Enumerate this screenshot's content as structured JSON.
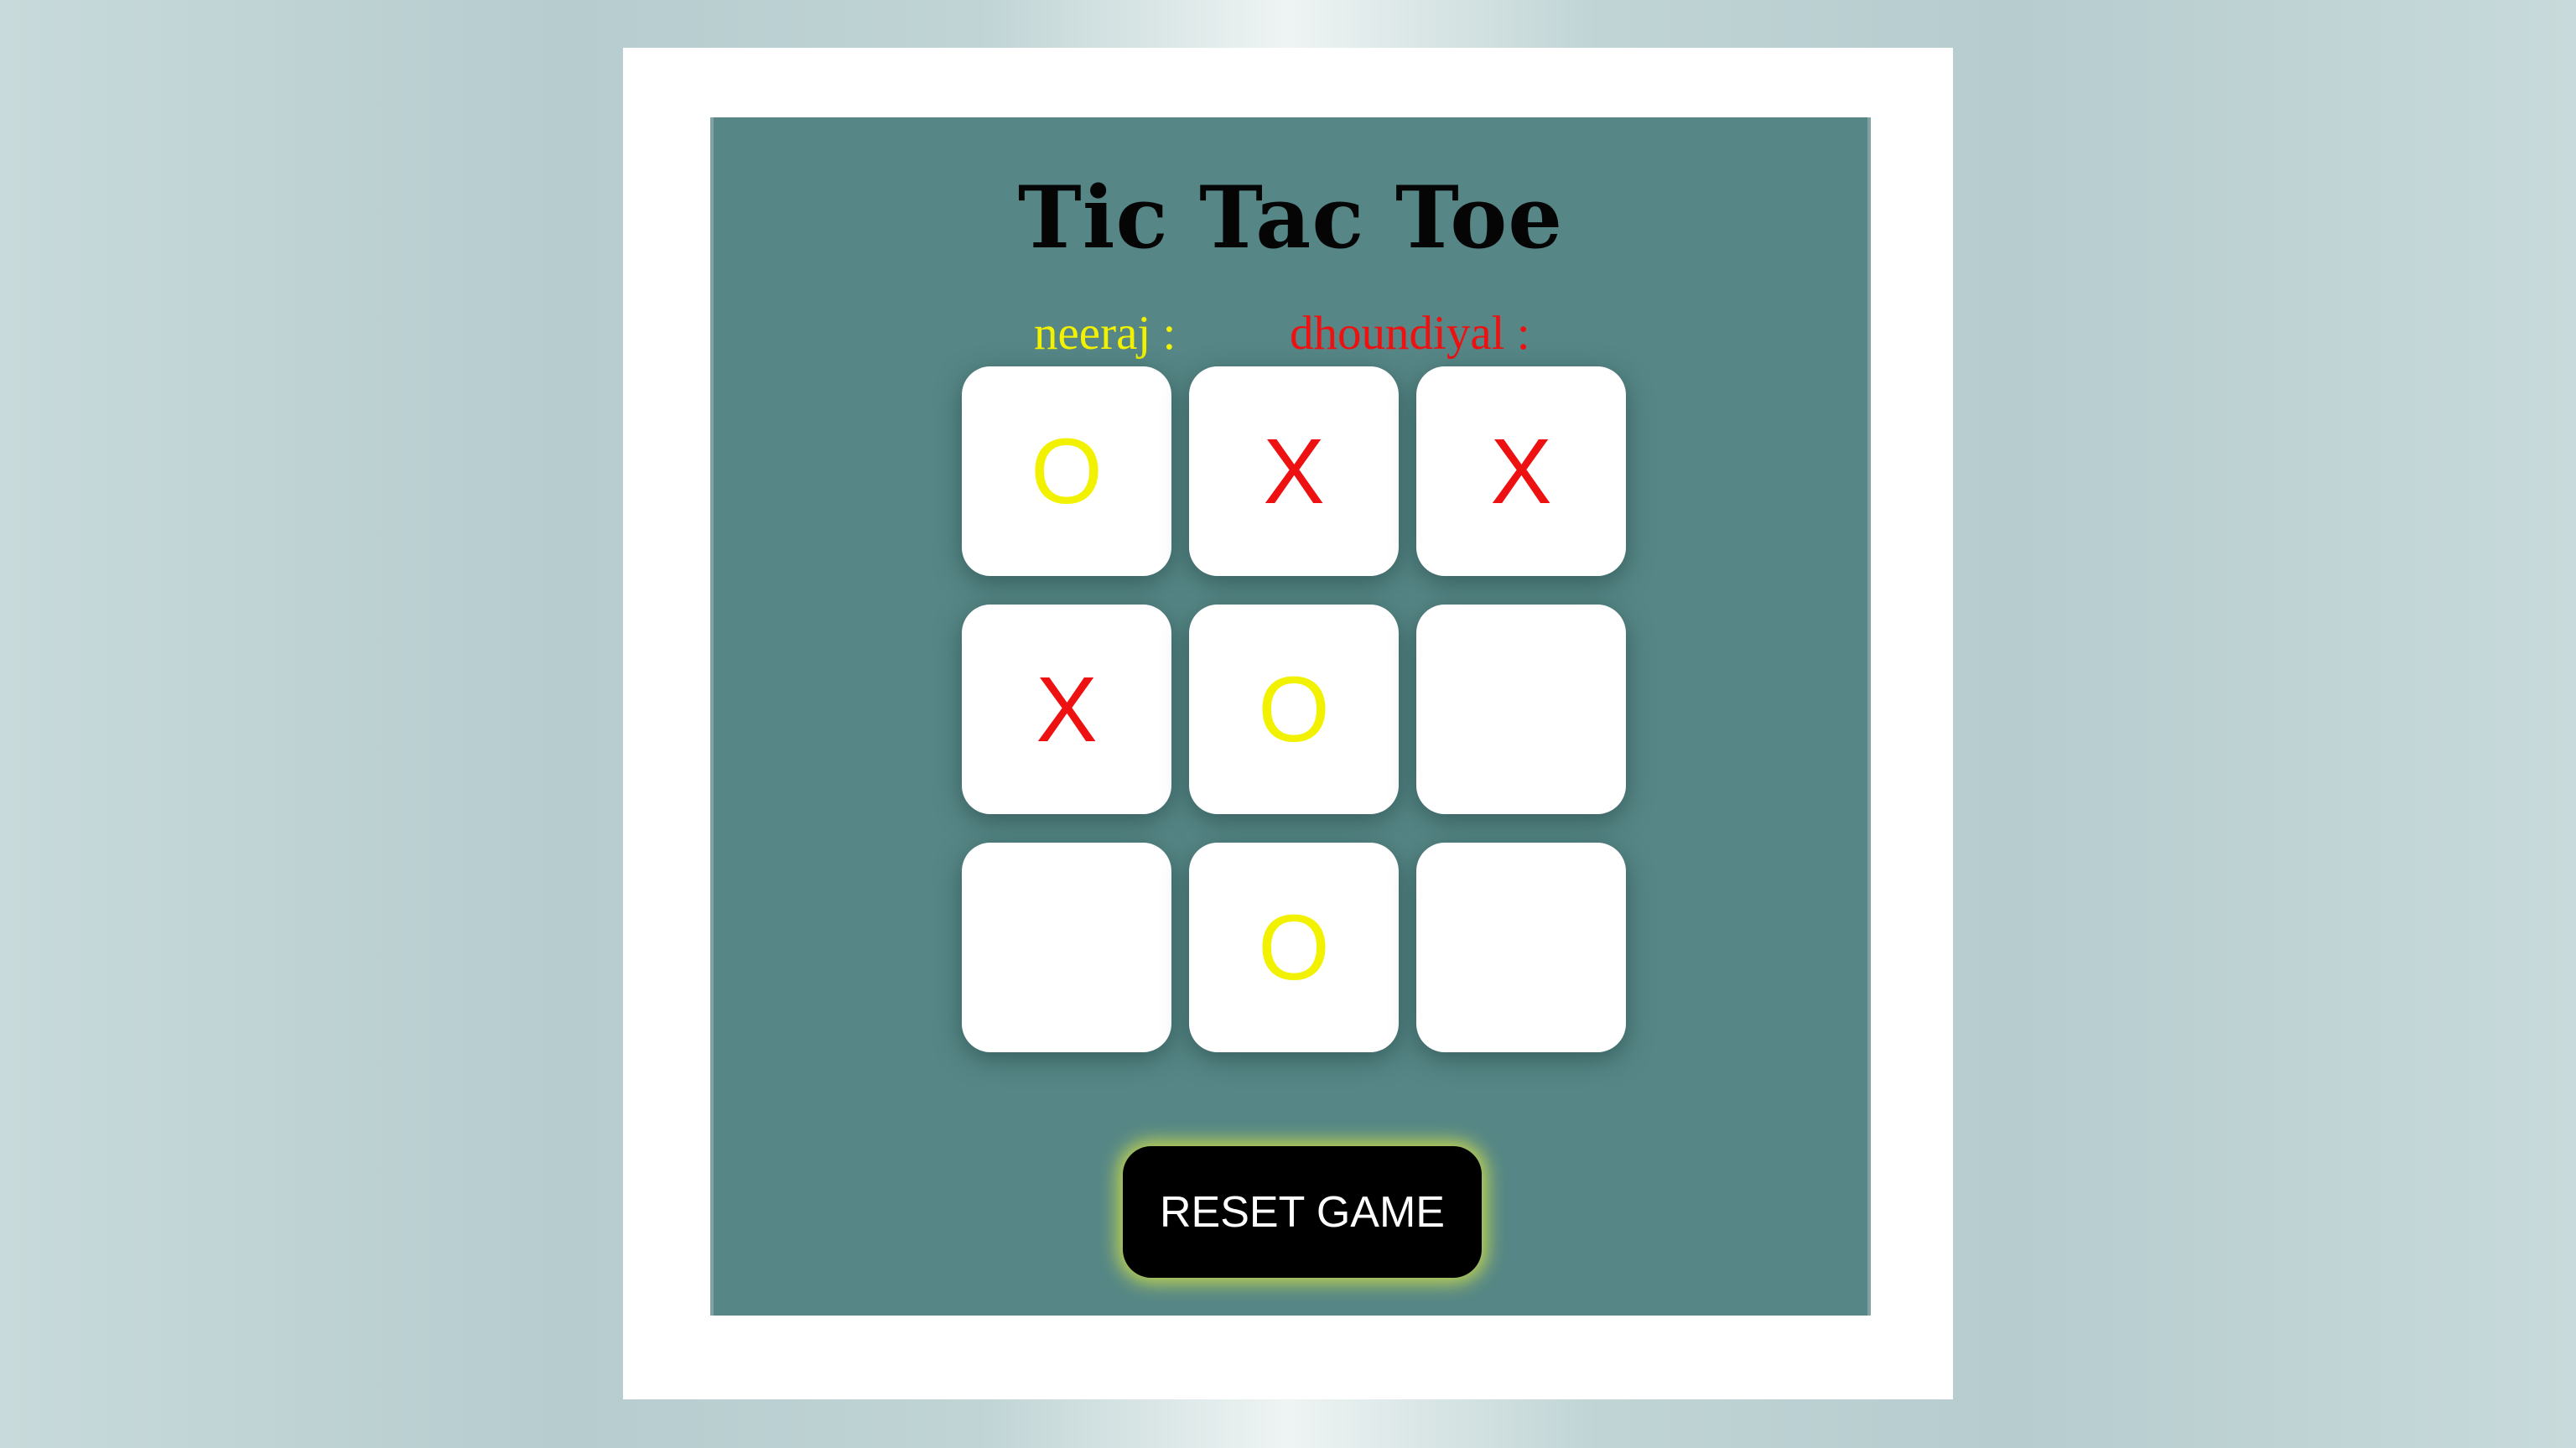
{
  "game": {
    "title": "Tic Tac Toe",
    "players": [
      {
        "label": "neeraj :",
        "color": "#f2f200"
      },
      {
        "label": "dhoundiyal :",
        "color": "#ee1111"
      }
    ],
    "board": [
      [
        "O",
        "X",
        "X"
      ],
      [
        "X",
        "O",
        ""
      ],
      [
        "",
        "O",
        ""
      ]
    ],
    "mark_colors": {
      "O": "#f2f200",
      "X": "#ee1111"
    },
    "reset_label": "RESET GAME"
  },
  "colors": {
    "panel_background": "#568786",
    "cell_background": "#ffffff",
    "button_background": "#000000",
    "button_glow": "#e8f03c"
  }
}
